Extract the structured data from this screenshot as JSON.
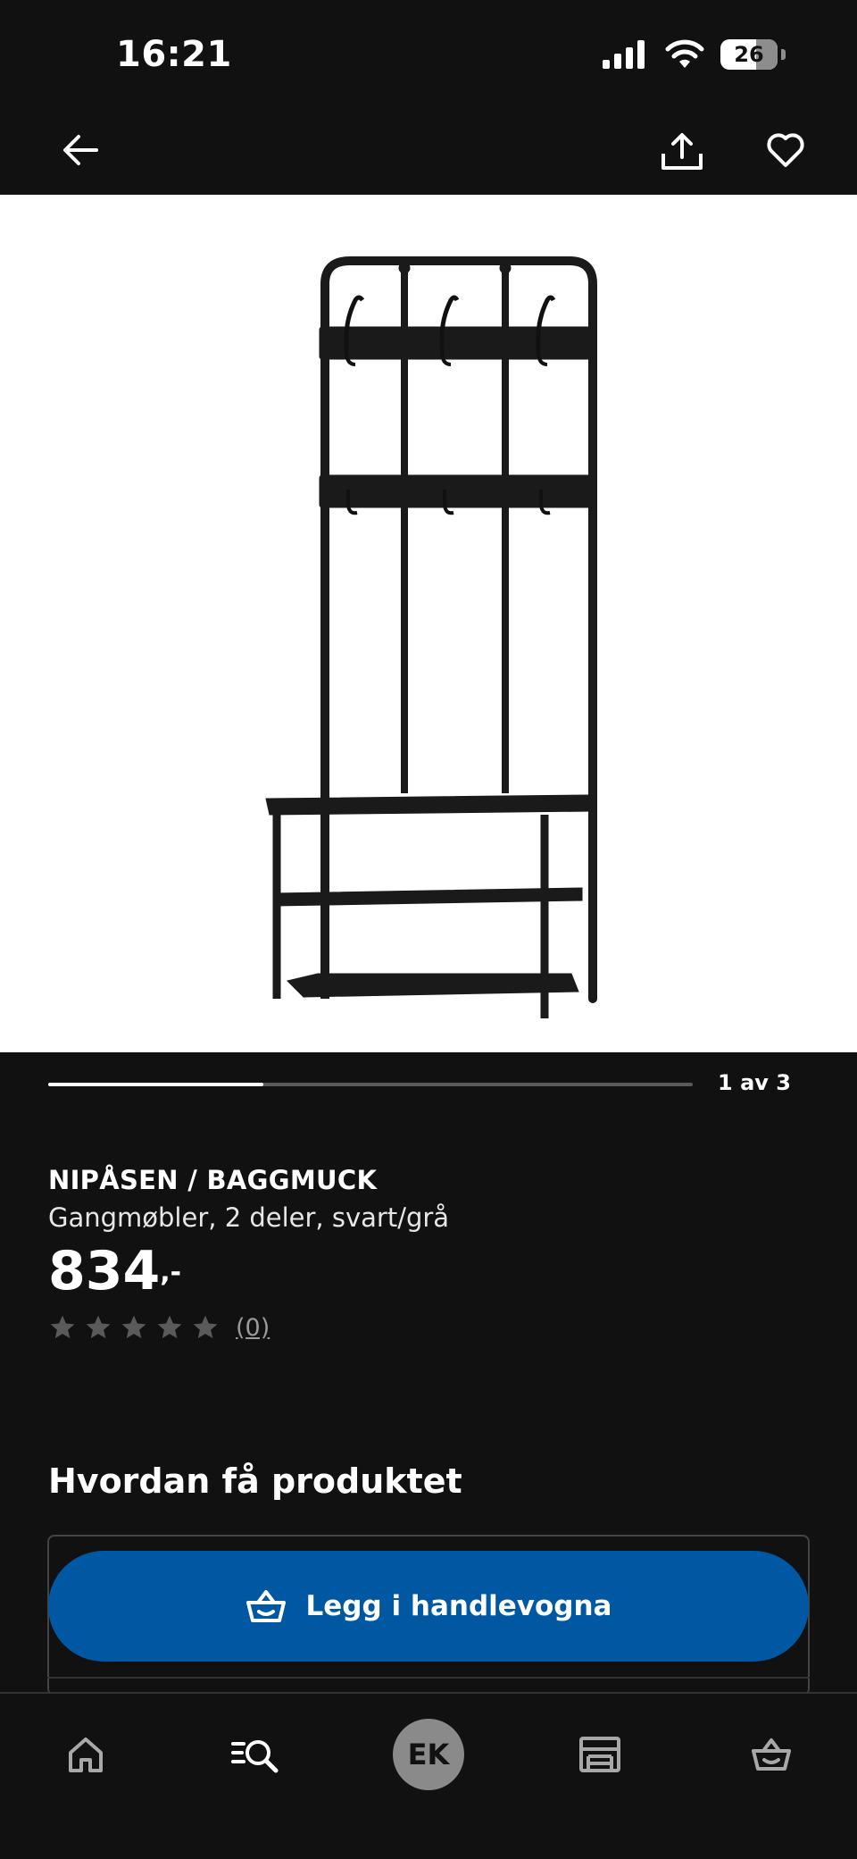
{
  "status_bar": {
    "time": "16:21",
    "battery": "26",
    "icons": [
      "signal-icon",
      "wifi-icon",
      "battery-icon"
    ]
  },
  "top_bar": {
    "icons": [
      "back-arrow-icon",
      "share-icon",
      "heart-icon"
    ]
  },
  "gallery": {
    "current": 1,
    "total": 3,
    "label": "1 av 3"
  },
  "product": {
    "name": "NIPÅSEN / BAGGMUCK",
    "description": "Gangmøbler, 2 deler, svart/grå",
    "price": "834",
    "price_suffix": ",-",
    "rating_stars": 0,
    "rating_max": 5,
    "rating_count": "(0)"
  },
  "section": {
    "title": "Hvordan få produktet"
  },
  "cart_button": {
    "label": "Legg i handlevogna",
    "color": "#0058a3"
  },
  "bottom_nav": {
    "items": [
      {
        "name": "home",
        "icon": "home-icon"
      },
      {
        "name": "search",
        "icon": "search-list-icon"
      },
      {
        "name": "profile",
        "avatar": "EK"
      },
      {
        "name": "stores",
        "icon": "store-icon"
      },
      {
        "name": "cart",
        "icon": "basket-icon"
      }
    ]
  },
  "colors": {
    "background": "#111111",
    "accent": "#0058a3",
    "text": "#ffffff"
  }
}
